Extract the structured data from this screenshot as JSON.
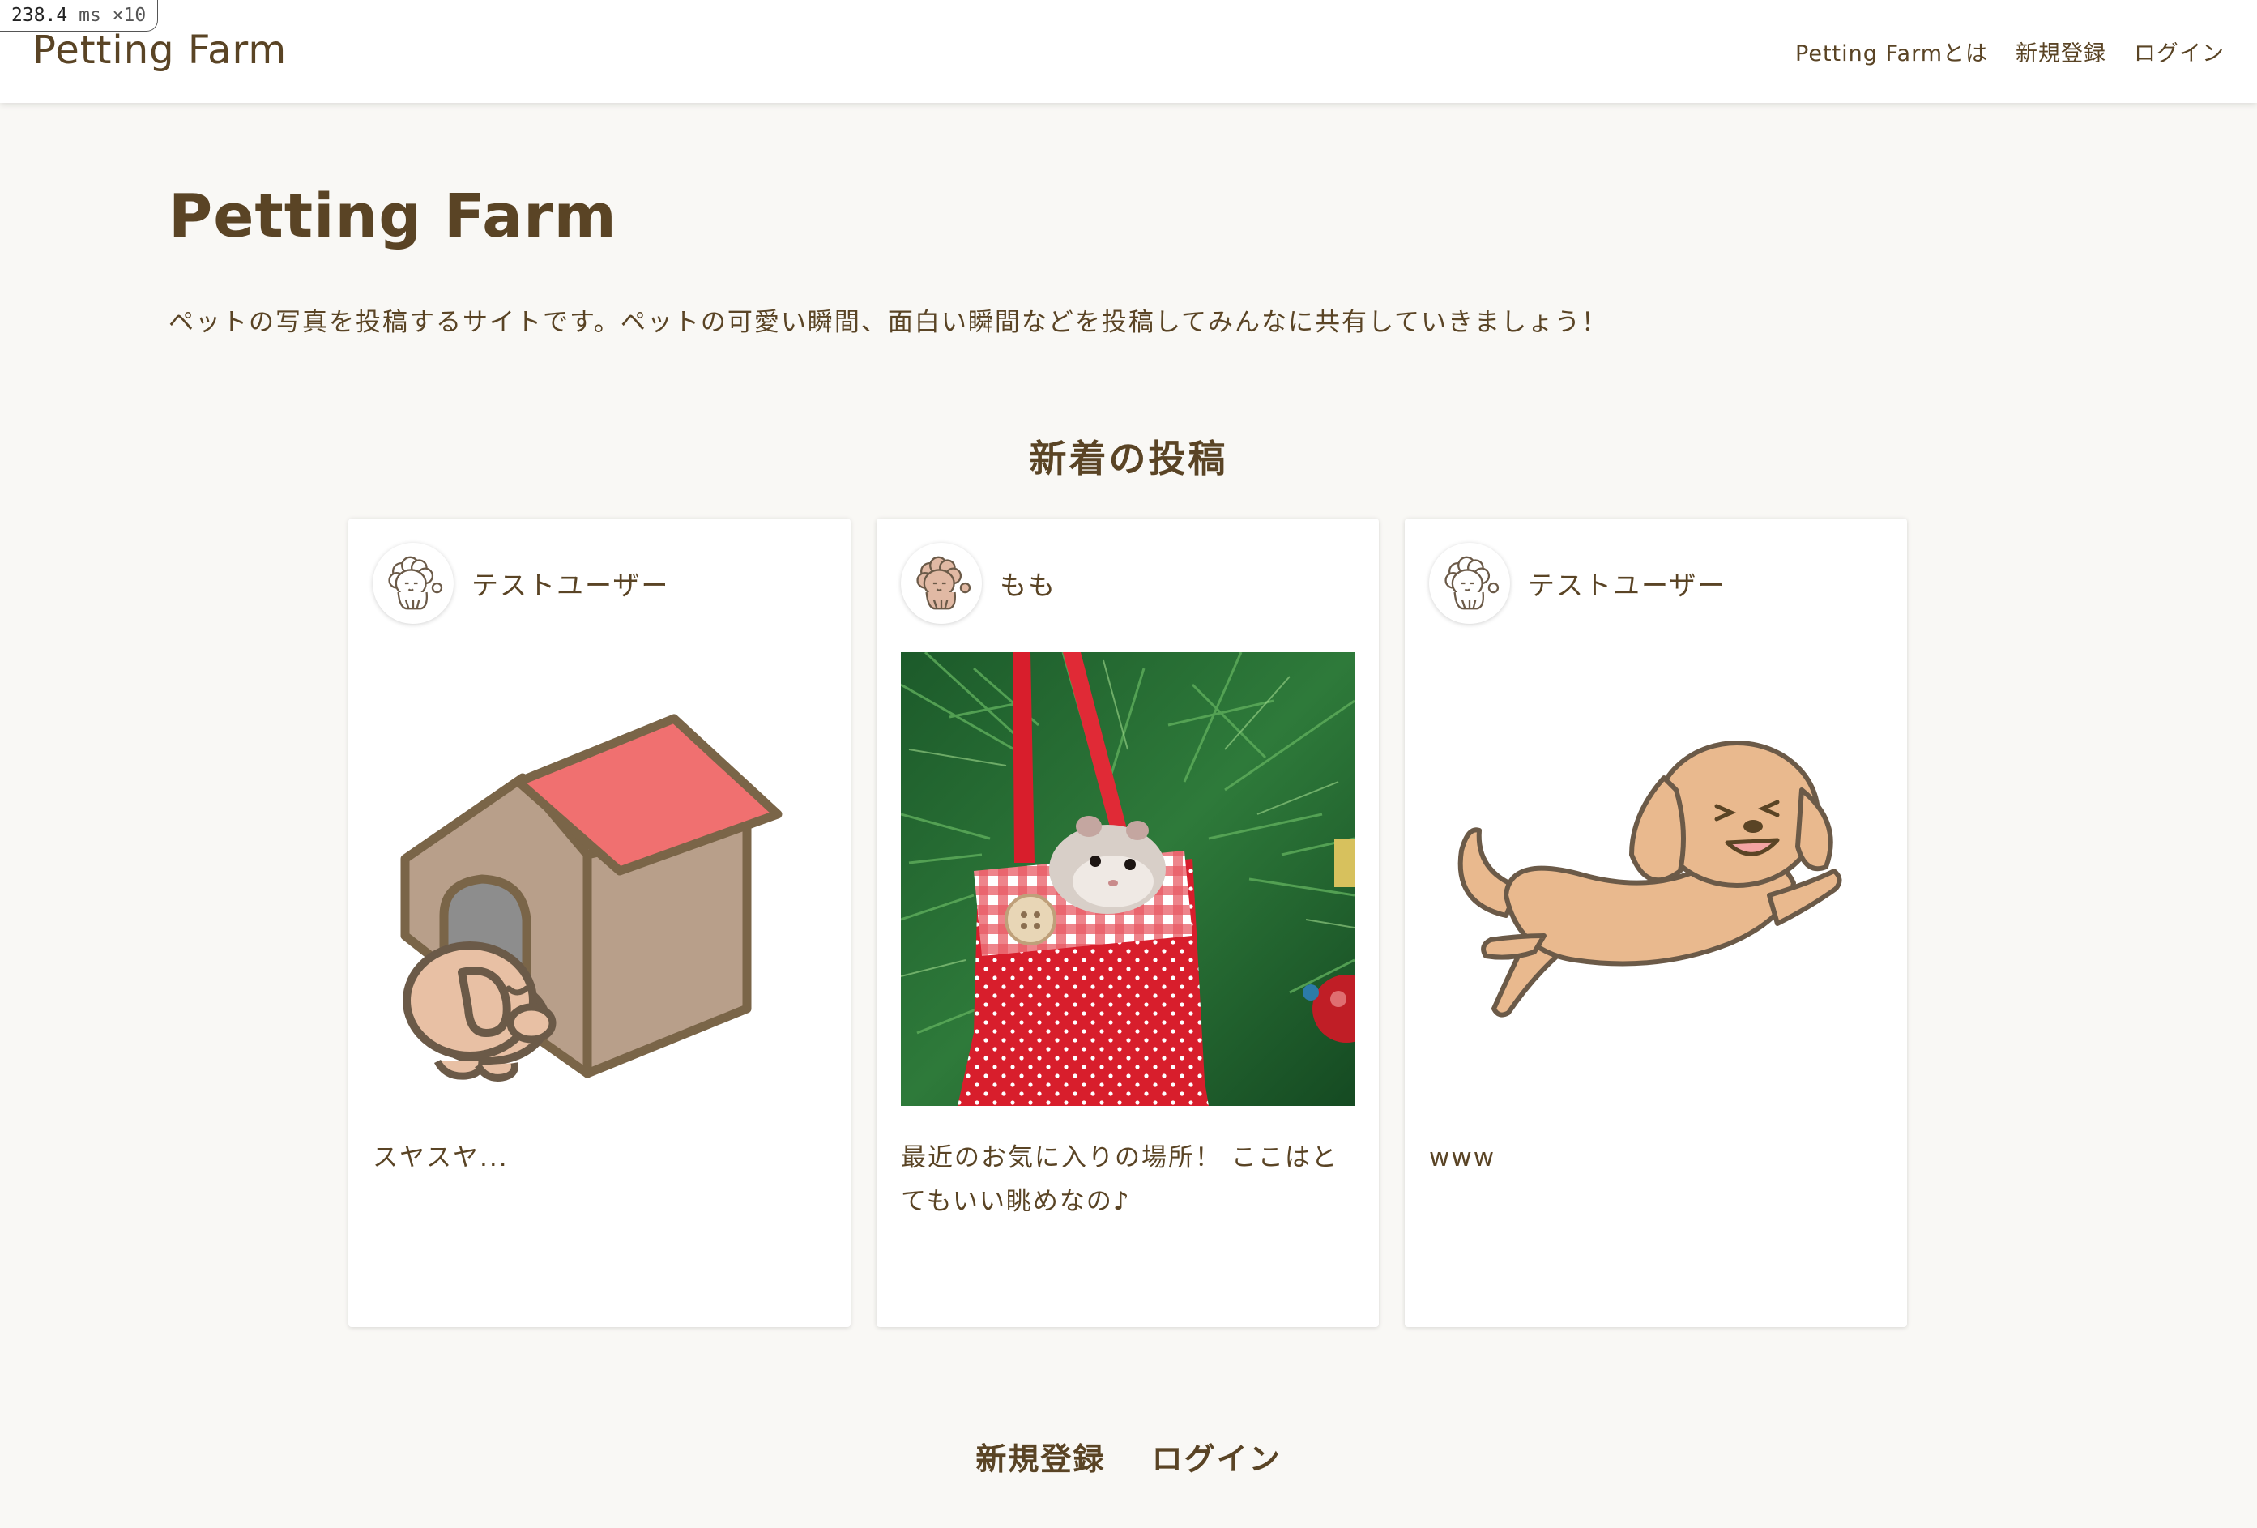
{
  "perf_badge": {
    "value": "238.4",
    "unit": "ms",
    "multiplier": "×10"
  },
  "header": {
    "logo": "Petting Farm",
    "nav": [
      {
        "label": "Petting Farmとは"
      },
      {
        "label": "新規登録"
      },
      {
        "label": "ログイン"
      }
    ]
  },
  "hero": {
    "title": "Petting Farm",
    "description": "ペットの写真を投稿するサイトです。ペットの可愛い瞬間、面白い瞬間などを投稿してみんなに共有していきましょう！"
  },
  "latest": {
    "title": "新着の投稿",
    "posts": [
      {
        "username": "テストユーザー",
        "text": "スヤスヤ...",
        "image": "sleeping-dog-doghouse-illustration"
      },
      {
        "username": "もも",
        "text": "最近のお気に入りの場所！ ここはとてもいい眺めなの♪",
        "image": "hamster-in-christmas-stocking-photo"
      },
      {
        "username": "テストユーザー",
        "text": "www",
        "image": "jumping-dog-illustration"
      }
    ]
  },
  "footer": {
    "signup": "新規登録",
    "login": "ログイン"
  },
  "colors": {
    "text_brown": "#5a4425",
    "page_background": "#f9f8f5",
    "card_background": "#ffffff",
    "roof_red": "#f07070",
    "dog_tan": "#e9b98e"
  }
}
